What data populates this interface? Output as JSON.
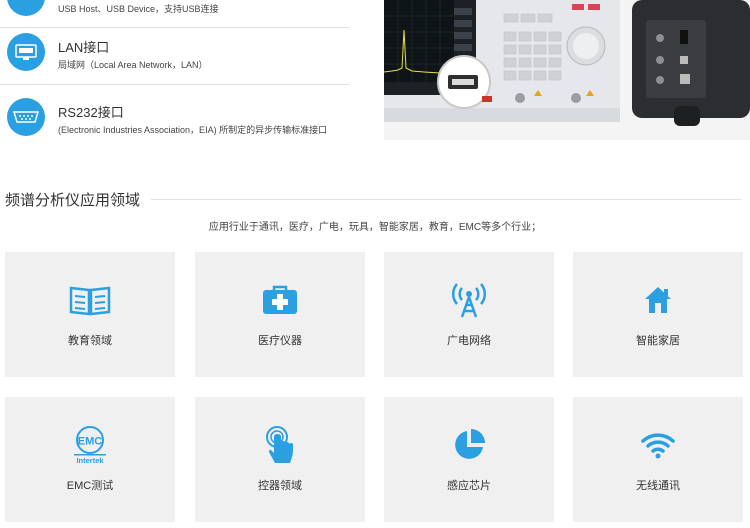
{
  "interfaces": [
    {
      "title": "",
      "desc": "USB Host、USB Device，支持USB连接"
    },
    {
      "title": "LAN接口",
      "desc": "局域网（Local Area Network，LAN）"
    },
    {
      "title": "RS232接口",
      "desc": "(Electronic Industries Association，EIA) 所制定的异步传输标准接口"
    }
  ],
  "section": {
    "title": "频谱分析仪应用领域",
    "subtitle": "应用行业于通讯，医疗，广电，玩具，智能家居，教育，EMC等多个行业；"
  },
  "fields": [
    {
      "label": "教育领域",
      "icon": "book-icon"
    },
    {
      "label": "医疗仪器",
      "icon": "medical-kit-icon"
    },
    {
      "label": "广电网络",
      "icon": "broadcast-tower-icon"
    },
    {
      "label": "智能家居",
      "icon": "home-icon"
    },
    {
      "label": "EMC测试",
      "icon": "emc-intertek-icon",
      "badge_top": "EMC",
      "badge_bottom": "Intertek"
    },
    {
      "label": "控器领域",
      "icon": "touch-hand-icon"
    },
    {
      "label": "感应芯片",
      "icon": "pie-chip-icon"
    },
    {
      "label": "无线通讯",
      "icon": "wifi-icon"
    }
  ],
  "colors": {
    "accent": "#2a9fe2",
    "tile_bg": "#f0f0f0"
  }
}
